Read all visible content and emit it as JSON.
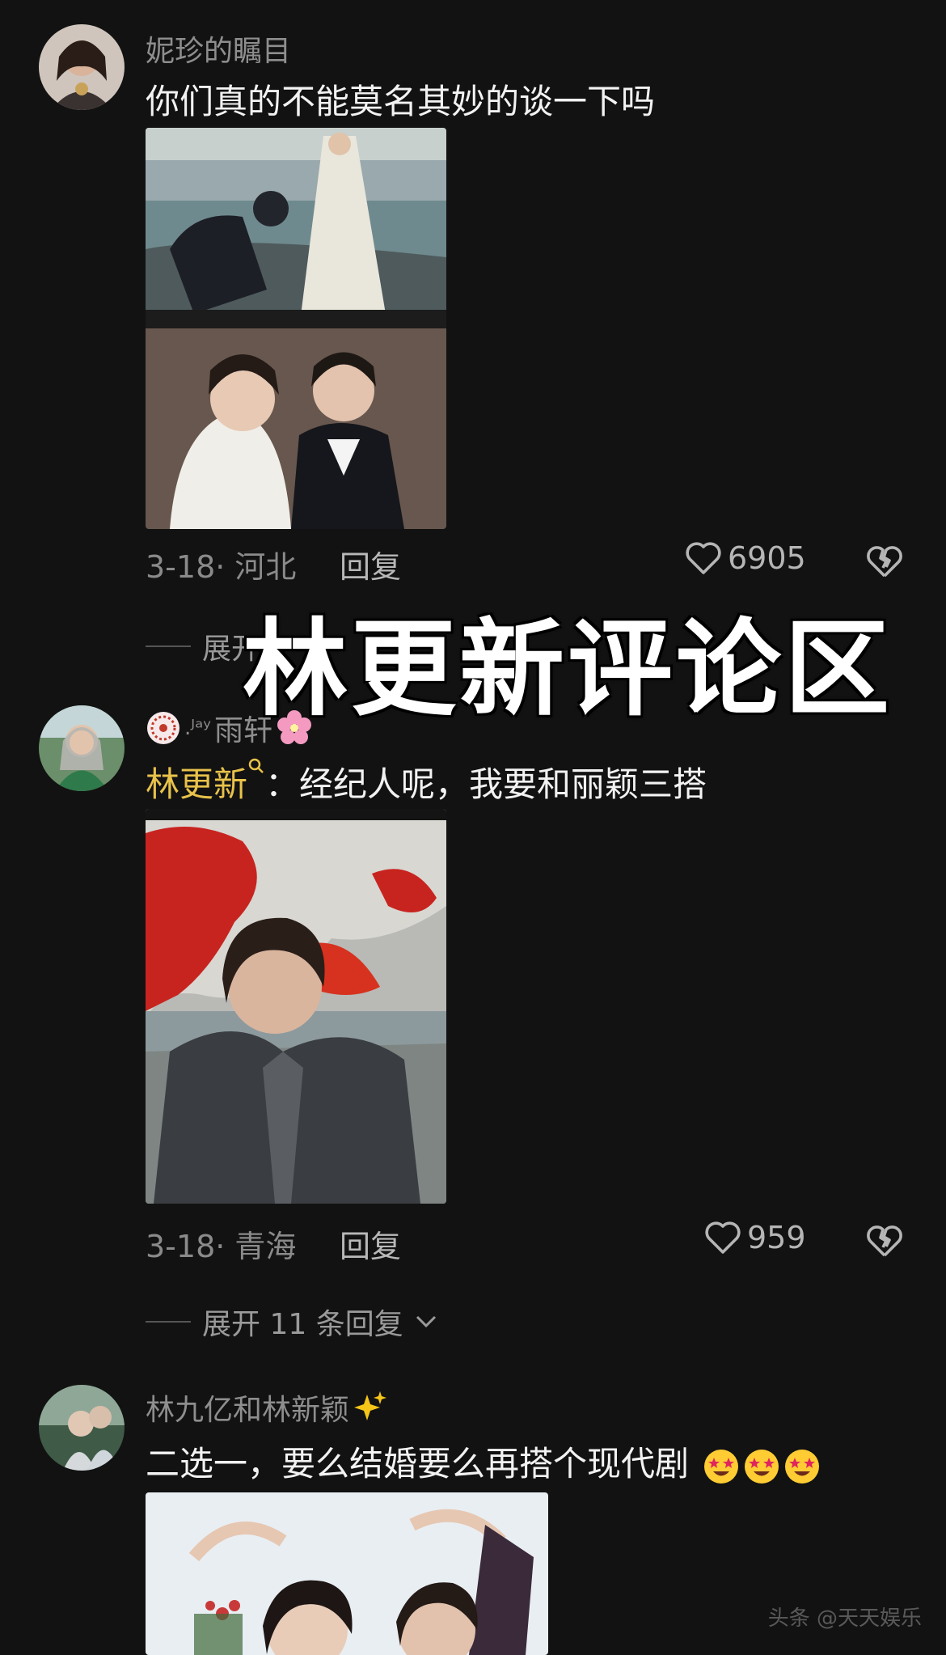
{
  "comments": [
    {
      "username": "妮珍的瞩目",
      "text": "你们真的不能莫名其妙的谈一下吗",
      "date_location": "3-18· 河北",
      "reply_label": "回复",
      "likes": "6905",
      "expand_label": "展开"
    },
    {
      "username_prefix": ".ᴶᵃʸ",
      "username": "雨轩",
      "mention": "林更新",
      "text": "：经纪人呢，我要和丽颖三搭",
      "date_location": "3-18· 青海",
      "reply_label": "回复",
      "likes": "959",
      "expand_label": "展开 11 条回复"
    },
    {
      "username": "林九亿和林新颖",
      "text": "二选一，要么结婚要么再搭个现代剧"
    }
  ],
  "overlay_title": "林更新评论区",
  "colors": {
    "background": "#121212",
    "mention": "#e8c24a",
    "muted": "#8e8e8e"
  }
}
